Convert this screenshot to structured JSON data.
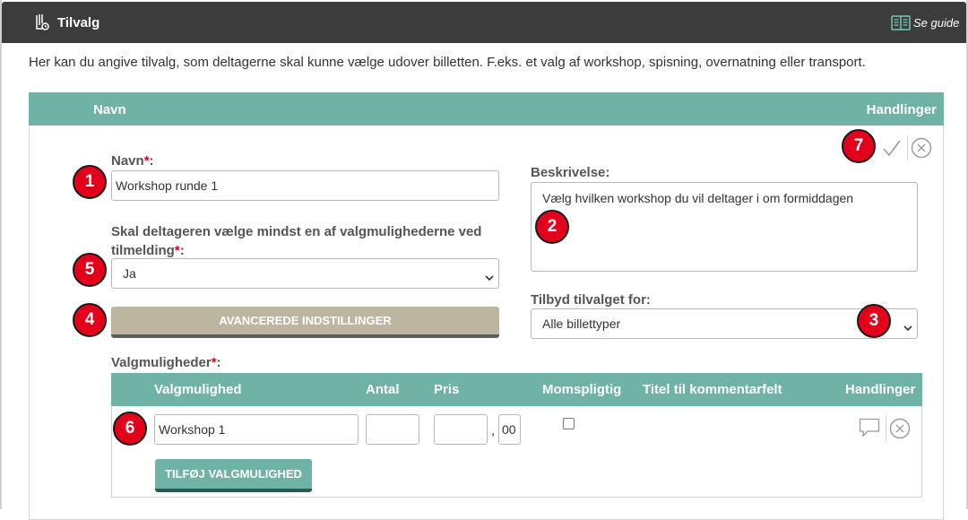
{
  "header": {
    "title": "Tilvalg",
    "guide_label": "Se guide",
    "title_icon": "gift-tag-icon",
    "guide_icon": "book-icon"
  },
  "intro_text": "Her kan du angive tilvalg, som deltagerne skal kunne vælge udover billetten. F.eks. et valg af workshop, spisning, overnatning eller transport.",
  "table": {
    "columns": {
      "name": "Navn",
      "actions": "Handlinger"
    }
  },
  "form": {
    "name_label": "Navn",
    "name_value": "Workshop runde 1",
    "required_marker": "*",
    "label_suffix": ":",
    "description_label": "Beskrivelse:",
    "description_value": "Vælg hvilken workshop du vil deltager i om formiddagen",
    "required_choice_label": "Skal deltageren vælge mindst en af valgmulighederne ved tilmelding",
    "required_choice_value": "Ja",
    "offer_for_label": "Tilbyd tilvalget for:",
    "offer_for_value": "Alle billettyper",
    "advanced_button": "AVANCEREDE INDSTILLINGER",
    "options_label": "Valgmuligheder"
  },
  "options_table": {
    "columns": {
      "option": "Valgmulighed",
      "quantity": "Antal",
      "price": "Pris",
      "vat": "Momspligtig",
      "comment_title": "Titel til kommentarfelt",
      "actions": "Handlinger"
    },
    "rows": [
      {
        "option": "Workshop 1",
        "quantity": "",
        "price": "",
        "price_separator": ",",
        "price_decimals": "00",
        "vat_checked": false
      }
    ],
    "add_button": "TILFØJ VALGMULIGHED"
  },
  "badges": [
    "1",
    "2",
    "3",
    "4",
    "5",
    "6",
    "7"
  ],
  "colors": {
    "header_bg": "#3c3c3c",
    "table_header": "#6fb2a6",
    "advanced_button": "#bcb5a0",
    "badge": "#e2001a",
    "required": "#e0001a"
  }
}
